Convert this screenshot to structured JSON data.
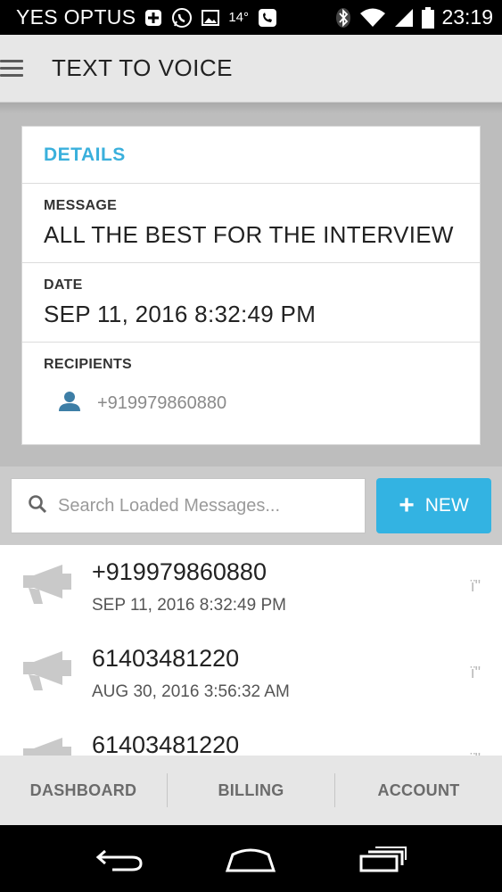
{
  "status_bar": {
    "carrier": "YES OPTUS",
    "temperature": "14°",
    "time": "23:19"
  },
  "app_bar": {
    "title": "TEXT TO VOICE"
  },
  "details": {
    "header": "DETAILS",
    "message_label": "MESSAGE",
    "message_value": "ALL THE BEST FOR THE INTERVIEW",
    "date_label": "DATE",
    "date_value": "SEP 11, 2016 8:32:49 PM",
    "recipients_label": "RECIPIENTS",
    "recipients": [
      "+919979860880"
    ]
  },
  "search": {
    "placeholder": "Search Loaded Messages...",
    "new_button_label": "NEW"
  },
  "messages": [
    {
      "number": "+919979860880",
      "date": "SEP 11, 2016 8:32:49 PM",
      "status": "ï\""
    },
    {
      "number": "61403481220",
      "date": "AUG 30, 2016 3:56:32 AM",
      "status": "ï\""
    },
    {
      "number": "61403481220",
      "date": "",
      "status": "ï\""
    }
  ],
  "tabs": [
    "DASHBOARD",
    "BILLING",
    "ACCOUNT"
  ],
  "colors": {
    "accent": "#33b3e2",
    "header_text": "#3ab0dc",
    "icon_gray": "#c9c9c9",
    "person_icon": "#3d7ea6"
  },
  "icons": {
    "menu": "hamburger-menu-icon",
    "search": "search-icon",
    "recipient": "person-icon",
    "message": "megaphone-icon"
  }
}
